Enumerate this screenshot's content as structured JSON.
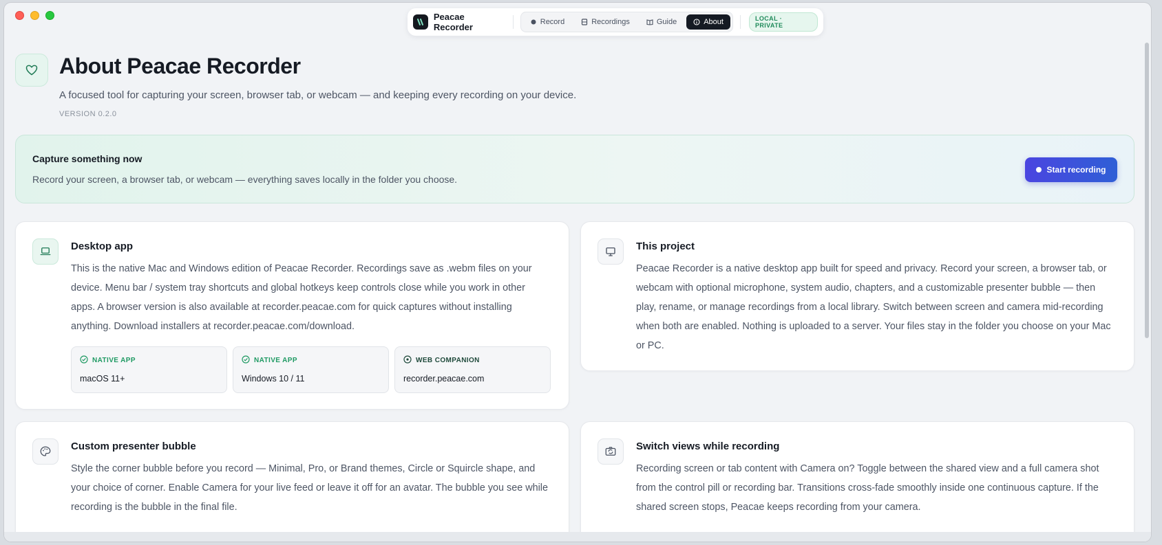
{
  "app": {
    "name": "Peacae Recorder",
    "badge": "LOCAL · PRIVATE"
  },
  "nav": {
    "tabs": [
      {
        "label": "Record",
        "icon": "dot-icon"
      },
      {
        "label": "Recordings",
        "icon": "film-icon"
      },
      {
        "label": "Guide",
        "icon": "book-icon"
      },
      {
        "label": "About",
        "icon": "info-icon",
        "active": true
      }
    ]
  },
  "hero": {
    "title": "About Peacae Recorder",
    "subtitle": "A focused tool for capturing your screen, browser tab, or webcam — and keeping every recording on your device.",
    "version": "VERSION 0.2.0",
    "icon": "heart-icon"
  },
  "capture": {
    "title": "Capture something now",
    "text": "Record your screen, a browser tab, or webcam — everything saves locally in the folder you choose.",
    "button_label": "Start recording"
  },
  "cards": {
    "desktop": {
      "title": "Desktop app",
      "text": "This is the native Mac and Windows edition of Peacae Recorder. Recordings save as .webm files on your device. Menu bar / system tray shortcuts and global hotkeys keep controls close while you work in other apps. A browser version is also available at recorder.peacae.com for quick captures without installing anything. Download installers at recorder.peacae.com/download.",
      "icon": "laptop-icon",
      "platforms": [
        {
          "label": "NATIVE APP",
          "value": "macOS 11+",
          "icon": "check-circle-icon"
        },
        {
          "label": "NATIVE APP",
          "value": "Windows 10 / 11",
          "icon": "check-circle-icon"
        },
        {
          "label": "WEB COMPANION",
          "value": "recorder.peacae.com",
          "icon": "globe-icon"
        }
      ]
    },
    "project": {
      "title": "This project",
      "text": "Peacae Recorder is a native desktop app built for speed and privacy. Record your screen, a browser tab, or webcam with optional microphone, system audio, chapters, and a customizable presenter bubble — then play, rename, or manage recordings from a local library. Switch between screen and camera mid-recording when both are enabled. Nothing is uploaded to a server. Your files stay in the folder you choose on your Mac or PC.",
      "icon": "monitor-icon"
    },
    "bubble": {
      "title": "Custom presenter bubble",
      "text": "Style the corner bubble before you record — Minimal, Pro, or Brand themes, Circle or Squircle shape, and your choice of corner. Enable Camera for your live feed or leave it off for an avatar. The bubble you see while recording is the bubble in the final file.",
      "icon": "palette-icon"
    },
    "switch": {
      "title": "Switch views while recording",
      "text": "Recording screen or tab content with Camera on? Toggle between the shared view and a full camera shot from the control pill or recording bar. Transitions cross-fade smoothly inside one continuous capture. If the shared screen stops, Peacae keeps recording from your camera.",
      "icon": "switch-camera-icon"
    }
  },
  "colors": {
    "accent": "#4a45e0",
    "green": "#1f9a63",
    "dark": "#151a23"
  }
}
